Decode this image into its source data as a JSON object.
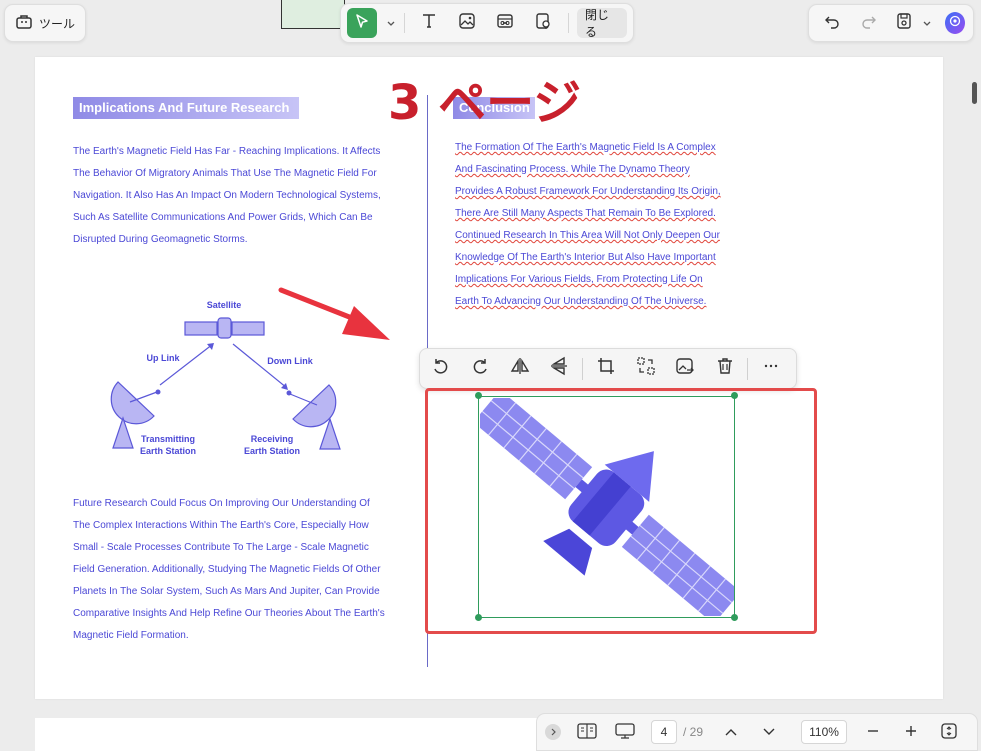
{
  "toolbar": {
    "tools_label": "ツール",
    "close_label": "閉じる"
  },
  "left_column": {
    "heading": "Implications And Future Research",
    "paragraph1": "The Earth's Magnetic Field Has Far - Reaching Implications. It Affects The Behavior Of Migratory Animals That Use The Magnetic Field For Navigation. It Also Has An Impact On Modern Technological Systems, Such As Satellite Communications And Power Grids, Which Can Be Disrupted During Geomagnetic Storms.",
    "paragraph2": "Future Research Could Focus On Improving Our Understanding Of The Complex Interactions Within The Earth's Core, Especially How Small - Scale Processes Contribute To The Large - Scale Magnetic Field Generation. Additionally, Studying The Magnetic Fields Of Other Planets In The Solar System, Such As Mars And Jupiter, Can Provide Comparative Insights And Help Refine Our Theories About The Earth's Magnetic Field Formation."
  },
  "diagram": {
    "satellite": "Satellite",
    "up_link": "Up Link",
    "down_link": "Down Link",
    "transmitting_line1": "Transmitting",
    "transmitting_line2": "Earth Station",
    "receiving_line1": "Receiving",
    "receiving_line2": "Earth Station"
  },
  "right_column": {
    "heading": "Conclusion",
    "paragraph": "The Formation Of The Earth's Magnetic Field Is A Complex And Fascinating Process. While The Dynamo Theory Provides A Robust Framework For Understanding Its Origin, There Are Still Many Aspects That Remain To Be Explored. Continued Research In This Area Will Not Only Deepen Our Knowledge Of The Earth's Interior But Also Have Important Implications For Various Fields, From Protecting Life On Earth To Advancing Our Understanding Of The Universe."
  },
  "annotation": {
    "page_label": "3 ページ"
  },
  "bottom_bar": {
    "current_page": "4",
    "total_pages": "/ 29",
    "zoom": "110%"
  },
  "colors": {
    "accent_green": "#3aa35b",
    "text_blue": "#4b48d6",
    "annotation_red": "#c8202c",
    "highlight_red": "#e34b4b"
  }
}
